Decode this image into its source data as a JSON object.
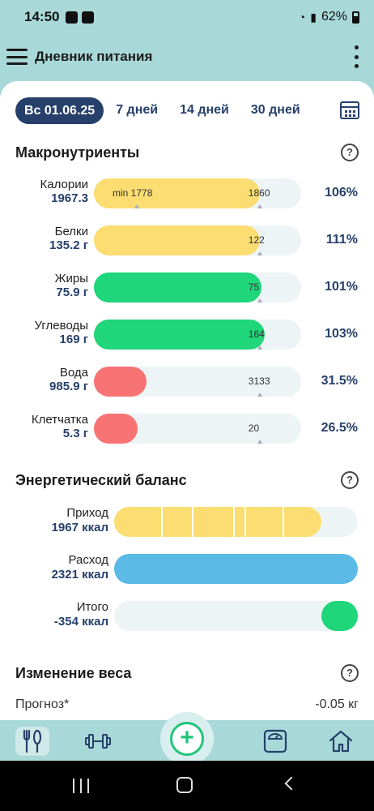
{
  "status_bar": {
    "time": "14:50",
    "battery": "62%"
  },
  "app_bar": {
    "title": "Дневник питания"
  },
  "date_selector": {
    "current": "Вс 01.06.25",
    "ranges": [
      "7 дней",
      "14 дней",
      "30 дней"
    ]
  },
  "macronutrients": {
    "title": "Макронутриенты",
    "rows": [
      {
        "label": "Калории",
        "value": "1967.3",
        "min_label": "min 1778",
        "target_label": "1860",
        "fill_pct": 100,
        "percent": "106%",
        "color": "#fbdd72"
      },
      {
        "label": "Белки",
        "value": "135.2 г",
        "min_label": "",
        "target_label": "122",
        "fill_pct": 100,
        "percent": "111%",
        "color": "#fbdd72"
      },
      {
        "label": "Жиры",
        "value": "75.9 г",
        "min_label": "",
        "target_label": "75",
        "fill_pct": 101,
        "percent": "101%",
        "color": "#1fd67a"
      },
      {
        "label": "Углеводы",
        "value": "169 г",
        "min_label": "",
        "target_label": "164",
        "fill_pct": 103,
        "percent": "103%",
        "color": "#1fd67a"
      },
      {
        "label": "Вода",
        "value": "985.9 г",
        "min_label": "",
        "target_label": "3133",
        "fill_pct": 31.5,
        "percent": "31.5%",
        "color": "#f87373"
      },
      {
        "label": "Клетчатка",
        "value": "5.3 г",
        "min_label": "",
        "target_label": "20",
        "fill_pct": 26.5,
        "percent": "26.5%",
        "color": "#f87373"
      }
    ]
  },
  "energy_balance": {
    "title": "Энергетический баланс",
    "rows": [
      {
        "label": "Приход",
        "value": "1967 ккал",
        "fill_pct": 85,
        "color": "#fbdd72"
      },
      {
        "label": "Расход",
        "value": "2321 ккал",
        "fill_pct": 100,
        "color": "#5cbae6"
      },
      {
        "label": "Итого",
        "value": "-354 ккал",
        "fill_pct": 15,
        "color": "#1fd67a"
      }
    ]
  },
  "weight_change": {
    "title": "Изменение веса",
    "forecast_label": "Прогноз*",
    "forecast_value": "-0.05 кг"
  },
  "bottom_nav": {
    "add_symbol": "+"
  },
  "icons": [
    "menu-icon",
    "more-vert-icon",
    "calendar-icon",
    "help-icon",
    "fork-knife-icon",
    "dumbbell-icon",
    "add-icon",
    "scale-icon",
    "home-icon"
  ]
}
